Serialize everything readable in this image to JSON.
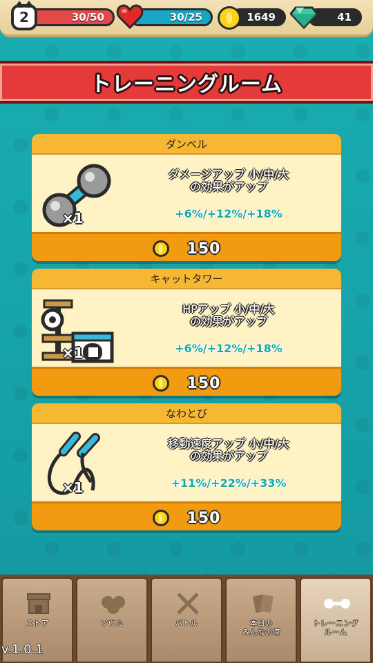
{
  "top_bar": {
    "level": "2",
    "hp_text": "30/50",
    "stamina_text": "30/25",
    "coins": "1649",
    "gems": "41"
  },
  "title": "トレーニングルーム",
  "cards": [
    {
      "name": "ダンベル",
      "icon": "dumbbell-icon",
      "qty": "×1",
      "desc_line1": "ダメージアップ 小/中/大",
      "desc_line2": "の効果がアップ",
      "effect": "+6%/+12%/+18%",
      "price": "150"
    },
    {
      "name": "キャットタワー",
      "icon": "cat-tower-icon",
      "qty": "×1",
      "desc_line1": "HPアップ 小/中/大",
      "desc_line2": "の効果がアップ",
      "effect": "+6%/+12%/+18%",
      "price": "150"
    },
    {
      "name": "なわとび",
      "icon": "jump-rope-icon",
      "qty": "×1",
      "desc_line1": "移動速度アップ 小/中/大",
      "desc_line2": "の効果がアップ",
      "effect": "+11%/+22%/+33%",
      "price": "150"
    }
  ],
  "nav": [
    {
      "label": "ストア",
      "icon": "store-icon"
    },
    {
      "label": "ソウル",
      "icon": "soul-icon"
    },
    {
      "label": "バトル",
      "icon": "swords-icon"
    },
    {
      "label_line1": "本日の",
      "label_line2": "みんなの塔",
      "icon": "cards-icon"
    },
    {
      "label_line1": "トレーニング",
      "label_line2": "ルーム",
      "icon": "dumbbell-icon",
      "active": true
    }
  ],
  "version": "v.1.0.1",
  "colors": {
    "background": "#16a3a7",
    "banner": "#e43a3a",
    "card_header": "#f6b733",
    "card_footer": "#f29a10",
    "effect_text": "#1aa7a4"
  }
}
